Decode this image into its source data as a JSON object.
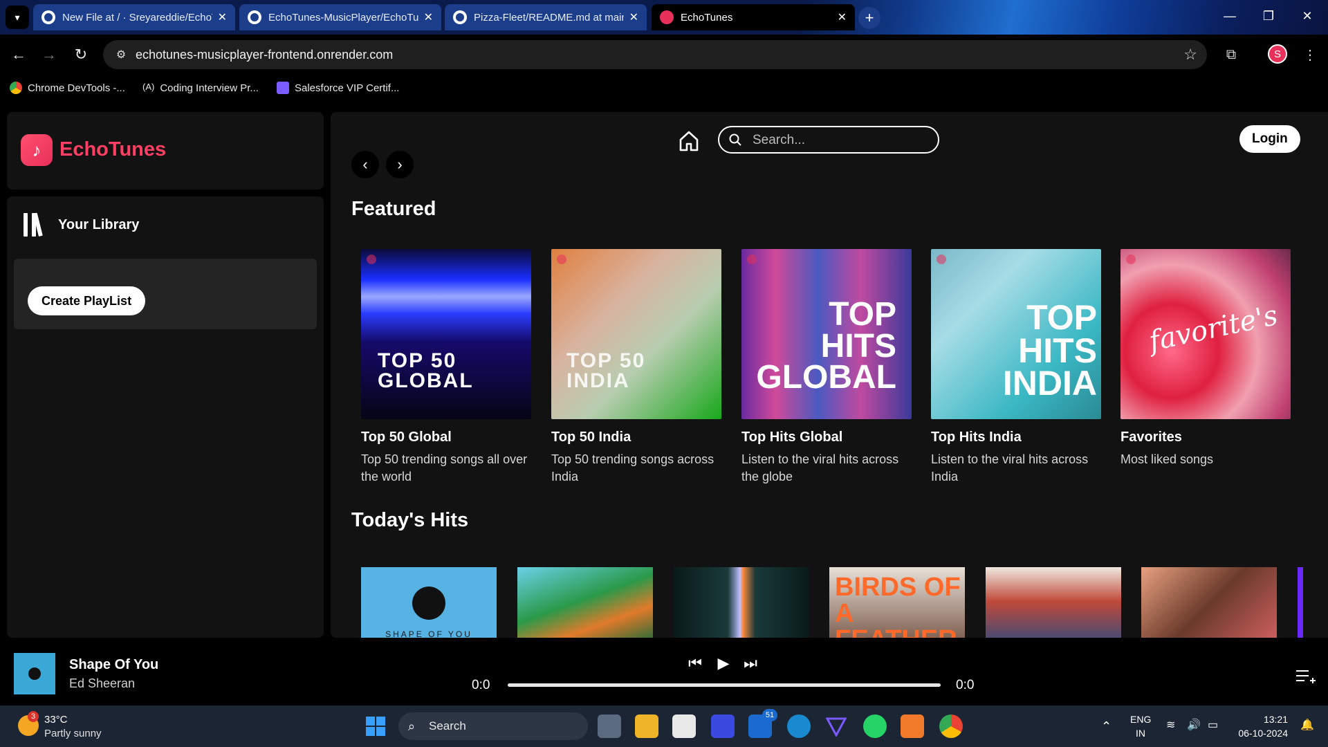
{
  "browser": {
    "tabs": [
      {
        "title": "New File at / · Sreyareddie/EchoTunes",
        "icon": "github-icon",
        "active": false
      },
      {
        "title": "EchoTunes-MusicPlayer/EchoTunes",
        "icon": "github-icon",
        "active": false
      },
      {
        "title": "Pizza-Fleet/README.md at main",
        "icon": "github-icon",
        "active": false
      },
      {
        "title": "EchoTunes",
        "icon": "echotunes-icon",
        "active": true
      }
    ],
    "url": "echotunes-musicplayer-frontend.onrender.com",
    "profile_initial": "S",
    "bookmarks": [
      {
        "label": "Chrome DevTools -...",
        "icon": "chrome-icon"
      },
      {
        "label": "Coding Interview Pr...",
        "icon": "code-icon"
      },
      {
        "label": "Salesforce VIP Certif...",
        "icon": "list-icon"
      }
    ]
  },
  "app": {
    "brand": "EchoTunes",
    "brand_color": "#ff3e63",
    "library_title": "Your Library",
    "create_playlist": "Create PlayList",
    "search_placeholder": "Search...",
    "login": "Login",
    "sections": {
      "featured": "Featured",
      "todays_hits": "Today's Hits"
    },
    "featured": [
      {
        "title": "Top 50 Global",
        "desc": "Top 50 trending songs all over the world",
        "cover_text": "TOP 50\nGLOBAL"
      },
      {
        "title": "Top 50 India",
        "desc": "Top 50 trending songs across India",
        "cover_text": "TOP 50\nINDIA"
      },
      {
        "title": "Top Hits Global",
        "desc": "Listen to the viral hits across the globe",
        "cover_text": "TOP\nHITS\nGLOBAL"
      },
      {
        "title": "Top Hits India",
        "desc": "Listen to the viral hits across India",
        "cover_text": "TOP\nHITS\nINDIA"
      },
      {
        "title": "Favorites",
        "desc": "Most liked songs",
        "cover_text": "favorite's"
      }
    ],
    "hits_cover_text": [
      "SHAPE OF YOU",
      "BIRDS OF A FEATHER"
    ]
  },
  "player": {
    "title": "Shape Of You",
    "artist": "Ed Sheeran",
    "time_current": "0:0",
    "time_total": "0:0"
  },
  "taskbar": {
    "temperature": "33°C",
    "weather": "Partly sunny",
    "weather_badge": "3",
    "search_label": "Search",
    "store_badge": "51",
    "lang": "ENG",
    "region": "IN",
    "time": "13:21",
    "date": "06-10-2024"
  }
}
